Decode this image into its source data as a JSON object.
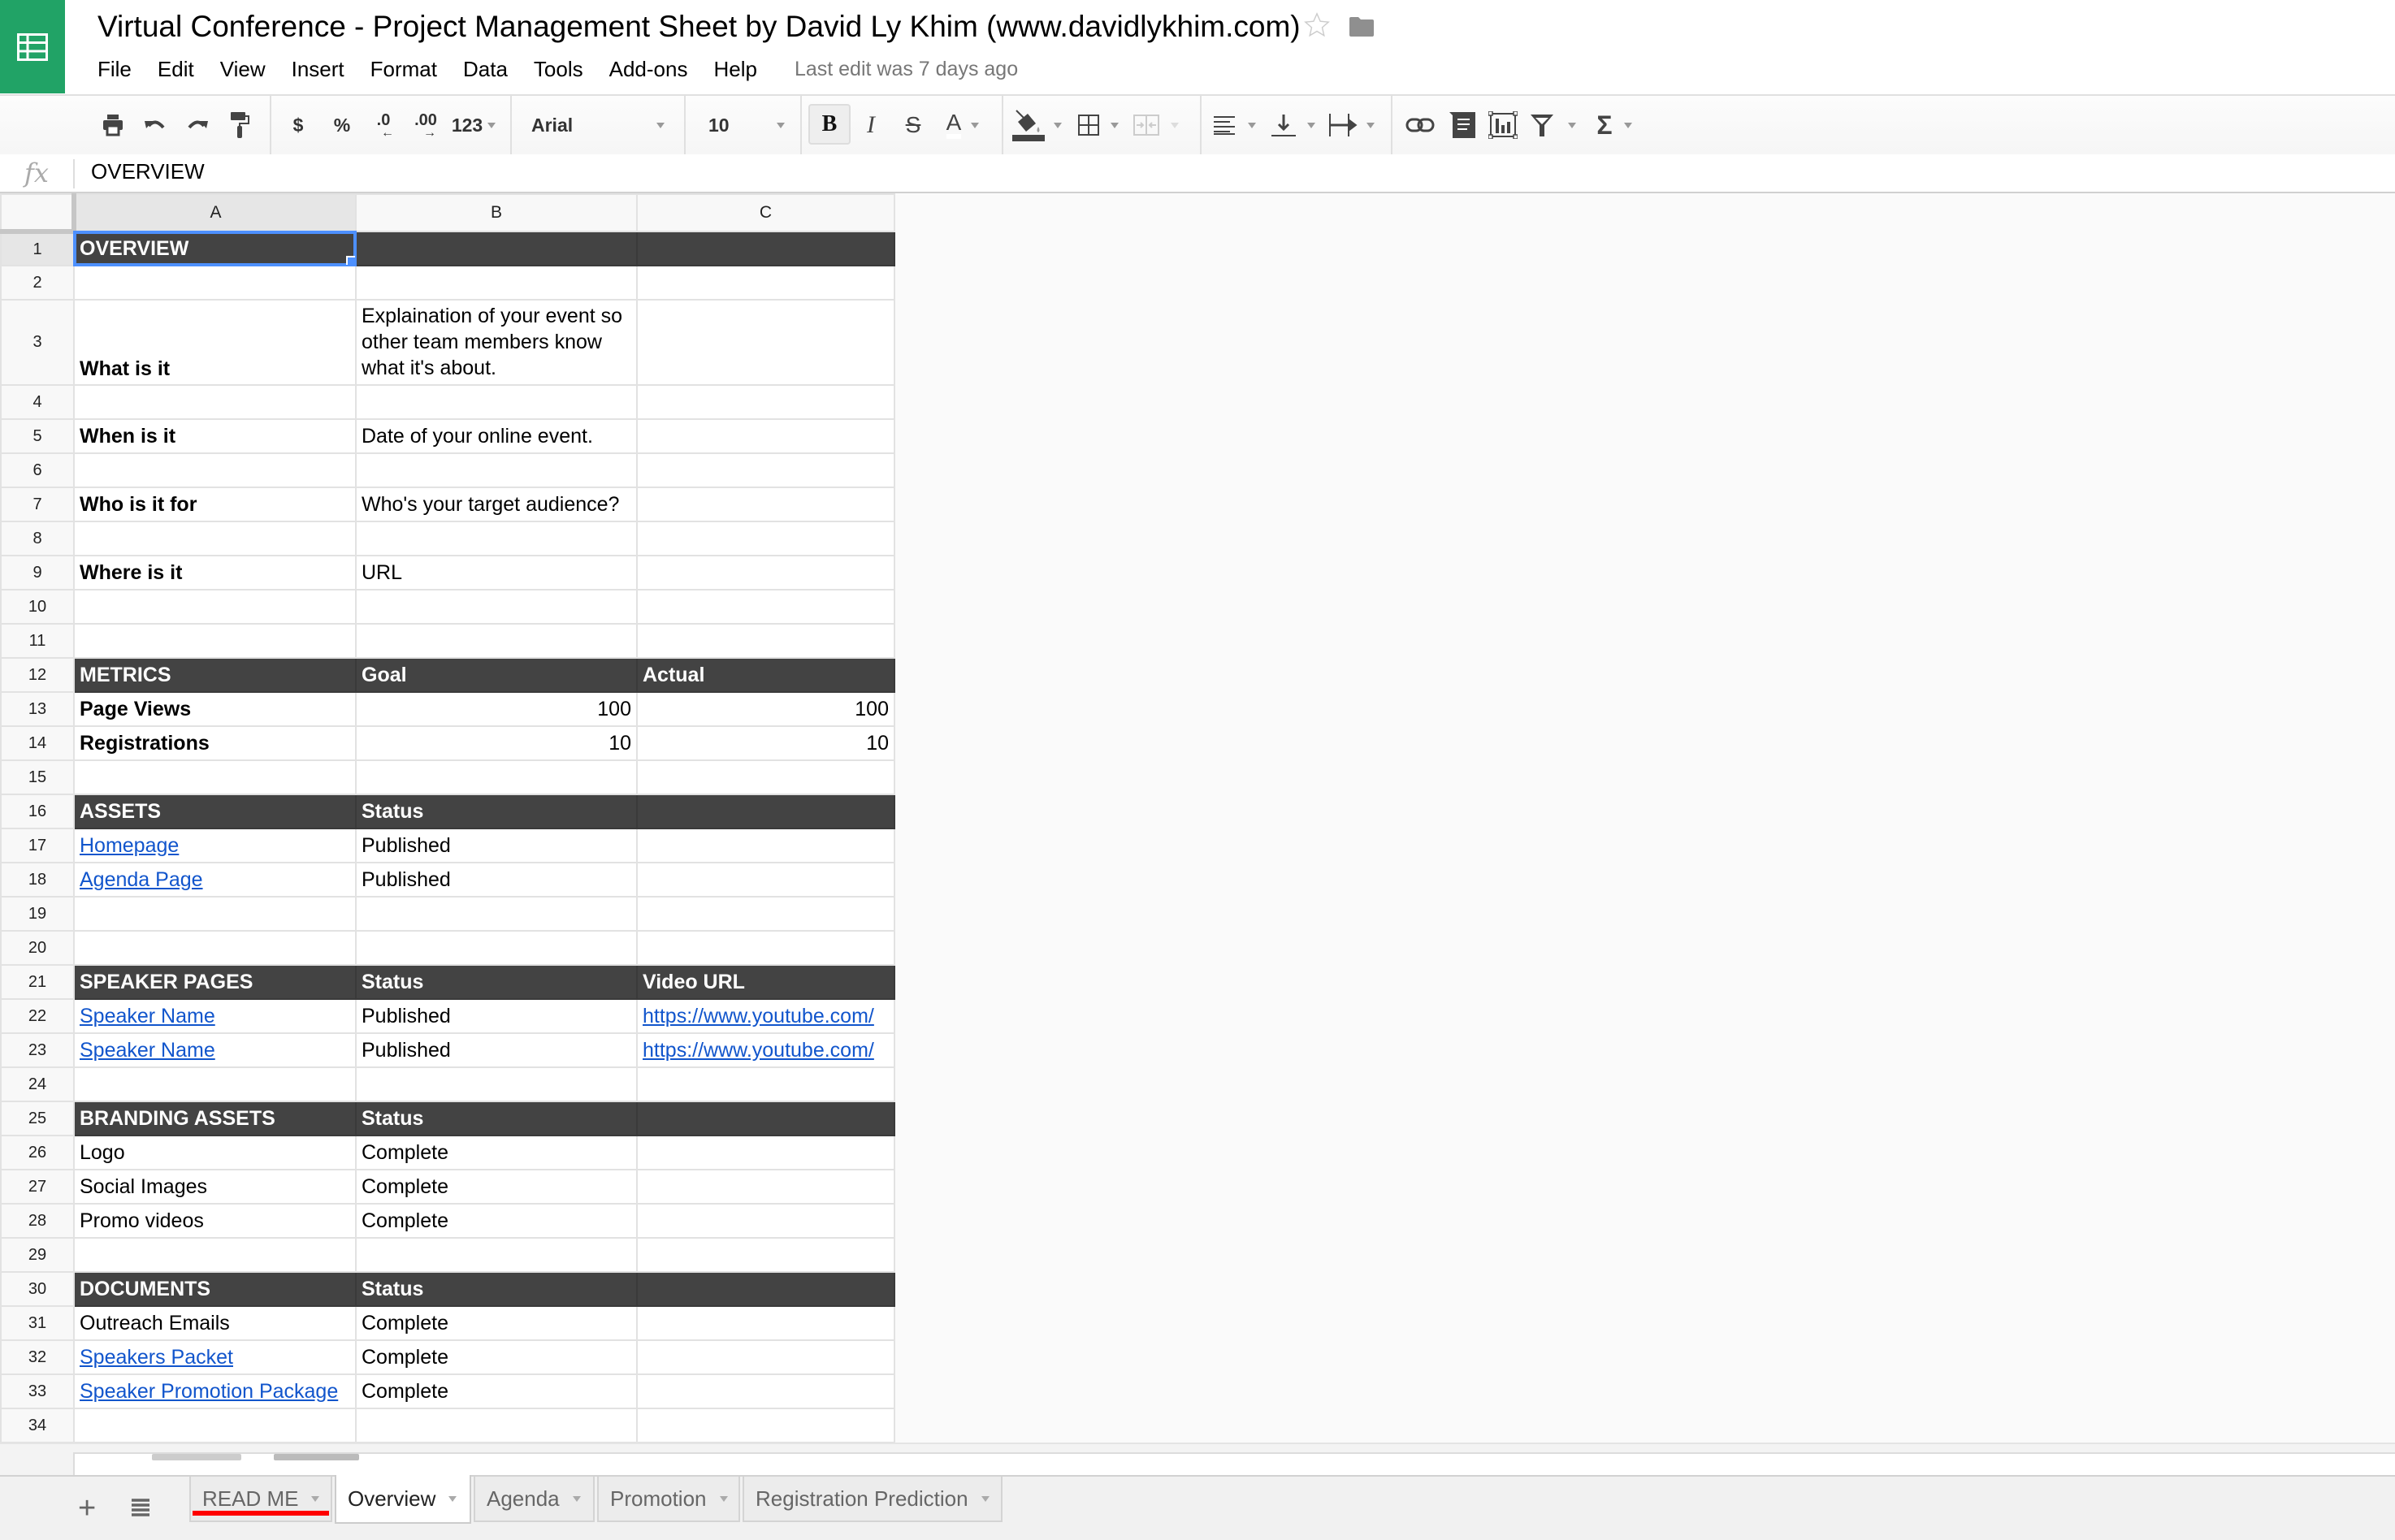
{
  "app": {
    "title": "Virtual Conference - Project Management Sheet by David Ly Khim (www.davidlykhim.com)",
    "last_edit": "Last edit was 7 days ago",
    "brand_color": "#21a366"
  },
  "menu": [
    "File",
    "Edit",
    "View",
    "Insert",
    "Format",
    "Data",
    "Tools",
    "Add-ons",
    "Help"
  ],
  "toolbar": {
    "currency": "$",
    "percent": "%",
    "decrease_decimal": ".0",
    "increase_decimal": ".00",
    "more_formats": "123",
    "font": "Arial",
    "font_size": "10",
    "bold": "B",
    "italic": "I",
    "strikethrough": "S",
    "text_color": "A",
    "sum": "Σ"
  },
  "formula_bar": {
    "fx": "fx",
    "value": "OVERVIEW"
  },
  "grid": {
    "columns": [
      "A",
      "B",
      "C"
    ],
    "selected_cell": "A1",
    "rows": [
      {
        "n": "1",
        "cells": [
          "OVERVIEW",
          "",
          ""
        ]
      },
      {
        "n": "2",
        "cells": [
          "",
          "",
          ""
        ]
      },
      {
        "n": "3",
        "cells": [
          "What is it",
          "Explaination of your event so other team members know what it's about.",
          ""
        ]
      },
      {
        "n": "4",
        "cells": [
          "",
          "",
          ""
        ]
      },
      {
        "n": "5",
        "cells": [
          "When is it",
          "Date of your online event.",
          ""
        ]
      },
      {
        "n": "6",
        "cells": [
          "",
          "",
          ""
        ]
      },
      {
        "n": "7",
        "cells": [
          "Who is it for",
          "Who's your target audience?",
          ""
        ]
      },
      {
        "n": "8",
        "cells": [
          "",
          "",
          ""
        ]
      },
      {
        "n": "9",
        "cells": [
          "Where is it",
          "URL",
          ""
        ]
      },
      {
        "n": "10",
        "cells": [
          "",
          "",
          ""
        ]
      },
      {
        "n": "11",
        "cells": [
          "",
          "",
          ""
        ]
      },
      {
        "n": "12",
        "cells": [
          "METRICS",
          "Goal",
          "Actual"
        ]
      },
      {
        "n": "13",
        "cells": [
          "Page Views",
          "100",
          "100"
        ]
      },
      {
        "n": "14",
        "cells": [
          "Registrations",
          "10",
          "10"
        ]
      },
      {
        "n": "15",
        "cells": [
          "",
          "",
          ""
        ]
      },
      {
        "n": "16",
        "cells": [
          "ASSETS",
          "Status",
          ""
        ]
      },
      {
        "n": "17",
        "cells": [
          "Homepage",
          "Published",
          ""
        ]
      },
      {
        "n": "18",
        "cells": [
          "Agenda Page",
          "Published",
          ""
        ]
      },
      {
        "n": "19",
        "cells": [
          "",
          "",
          ""
        ]
      },
      {
        "n": "20",
        "cells": [
          "",
          "",
          ""
        ]
      },
      {
        "n": "21",
        "cells": [
          "SPEAKER PAGES",
          "Status",
          "Video URL"
        ]
      },
      {
        "n": "22",
        "cells": [
          "Speaker Name",
          "Published",
          "https://www.youtube.com/"
        ]
      },
      {
        "n": "23",
        "cells": [
          "Speaker Name",
          "Published",
          "https://www.youtube.com/"
        ]
      },
      {
        "n": "24",
        "cells": [
          "",
          "",
          ""
        ]
      },
      {
        "n": "25",
        "cells": [
          "BRANDING ASSETS",
          "Status",
          ""
        ]
      },
      {
        "n": "26",
        "cells": [
          "Logo",
          "Complete",
          ""
        ]
      },
      {
        "n": "27",
        "cells": [
          "Social Images",
          "Complete",
          ""
        ]
      },
      {
        "n": "28",
        "cells": [
          "Promo videos",
          "Complete",
          ""
        ]
      },
      {
        "n": "29",
        "cells": [
          "",
          "",
          ""
        ]
      },
      {
        "n": "30",
        "cells": [
          "DOCUMENTS",
          "Status",
          ""
        ]
      },
      {
        "n": "31",
        "cells": [
          "Outreach Emails",
          "Complete",
          ""
        ]
      },
      {
        "n": "32",
        "cells": [
          "Speakers Packet",
          "Complete",
          ""
        ]
      },
      {
        "n": "33",
        "cells": [
          "Speaker Promotion Package",
          "Complete",
          ""
        ]
      },
      {
        "n": "34",
        "cells": [
          "",
          "",
          ""
        ]
      }
    ],
    "header_fill": "#434343",
    "link_color": "#1155cc"
  },
  "sheet_tabs": {
    "add_label": "+",
    "tabs": [
      {
        "label": "READ ME",
        "active": false,
        "color": "#ff0000"
      },
      {
        "label": "Overview",
        "active": true
      },
      {
        "label": "Agenda",
        "active": false
      },
      {
        "label": "Promotion",
        "active": false
      },
      {
        "label": "Registration Prediction",
        "active": false
      }
    ]
  }
}
